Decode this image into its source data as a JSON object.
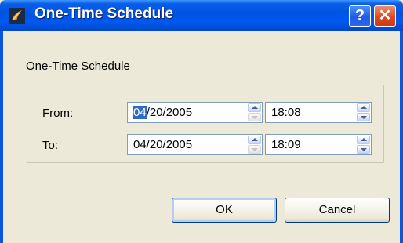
{
  "window": {
    "title": "One-Time Schedule",
    "help_glyph": "?",
    "close_glyph": "✕"
  },
  "group": {
    "title": "One-Time Schedule"
  },
  "from": {
    "label": "From:",
    "date_month": "04",
    "date_rest": "/20/2005",
    "time": "18:08"
  },
  "to": {
    "label": "To:",
    "date": "04/20/2005",
    "time": "18:09"
  },
  "buttons": {
    "ok": "OK",
    "cancel": "Cancel"
  },
  "icons": {
    "app": "clock-flame-icon",
    "help": "help-icon",
    "close": "close-icon",
    "spin": "spin-arrows-icon"
  },
  "colors": {
    "titlebar": "#0054e3",
    "dialog_bg": "#ece9d8",
    "selection": "#316ac5"
  }
}
